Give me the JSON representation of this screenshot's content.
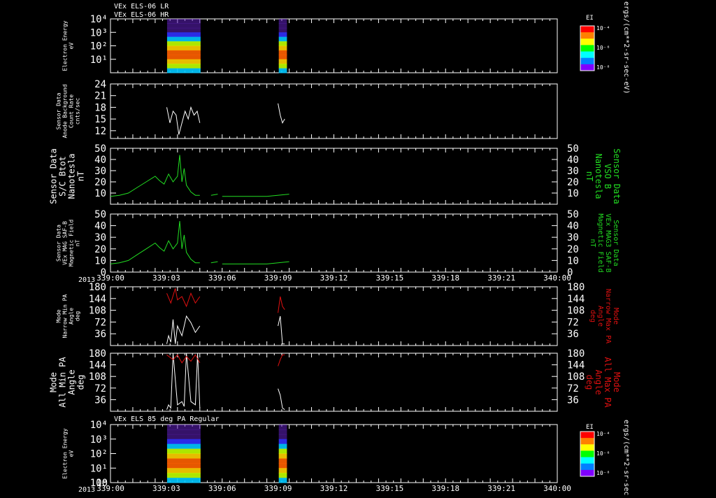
{
  "header": {
    "line1": "VEx ELS-06 LR",
    "line2": "VEx ELS-06 HR",
    "bottom_panel_title": "VEx ELS 85 deg PA Regular",
    "year": "2013"
  },
  "colors": {
    "white": "#ffffff",
    "green": "#22dd22",
    "red": "#e01010",
    "background": "#000000"
  },
  "time_axis": {
    "start": "339:00",
    "end": "340:00",
    "ticks": [
      "339:00",
      "339:03",
      "339:06",
      "339:09",
      "339:12",
      "339:15",
      "339:18",
      "339:21",
      "340:00"
    ],
    "major_tick_fractions": [
      0,
      0.125,
      0.25,
      0.375,
      0.5,
      0.625,
      0.75,
      0.875,
      1.0
    ]
  },
  "colorbar": {
    "label": "EI",
    "units": "ergs/(cm**2-sr-sec-eV)",
    "tick_labels": [
      "10⁻⁴",
      "10⁻⁶",
      "10⁻⁸"
    ]
  },
  "chart_data": [
    {
      "type": "heatmap",
      "ylabel": [
        "Electron Energy",
        "eV"
      ],
      "y_scale": "log",
      "ylim": [
        1,
        10000
      ],
      "y_tick_labels": [
        "10⁴",
        "10³",
        "10²",
        "10¹"
      ],
      "data_intervals": [
        [
          "339:07.6",
          "339:12.1"
        ],
        [
          "339:22.6",
          "339:23.7"
        ]
      ],
      "colorbar": true
    },
    {
      "type": "line",
      "ylabel": [
        "Sensor Data",
        "Anode Background",
        "Count Rate",
        "cnts/sec"
      ],
      "ylim": [
        10,
        24
      ],
      "y_ticks": [
        12,
        15,
        18,
        21,
        24
      ],
      "series": [
        {
          "color": "white",
          "segments": [
            {
              "t": [
                339.126,
                339.133,
                339.14,
                339.147,
                339.153,
                339.16,
                339.167,
                339.174,
                339.18,
                339.187,
                339.194,
                339.2
              ],
              "v": [
                18,
                14,
                17,
                16,
                11,
                14,
                17,
                15,
                18,
                16,
                17,
                14
              ]
            },
            {
              "t": [
                339.375,
                339.38,
                339.385,
                339.39
              ],
              "v": [
                19,
                16,
                14,
                15
              ]
            }
          ]
        }
      ]
    },
    {
      "type": "line",
      "ylabel": [
        "Sensor Data",
        "S/C Btot",
        "Nanotesla",
        "nT"
      ],
      "ylabel_right": [
        "Sensor Data",
        "VSO B",
        "Nanotesla",
        "nT"
      ],
      "ylim": [
        0,
        50
      ],
      "y_ticks": [
        10,
        20,
        30,
        40,
        50
      ],
      "series": [
        {
          "color": "green",
          "segments": [
            {
              "t": [
                339.0,
                339.02,
                339.04,
                339.06,
                339.08,
                339.1,
                339.11,
                339.12,
                339.13,
                339.14,
                339.15,
                339.155,
                339.16,
                339.165,
                339.17,
                339.18,
                339.19,
                339.2
              ],
              "v": [
                7,
                8,
                10,
                15,
                20,
                25,
                21,
                18,
                27,
                20,
                25,
                44,
                20,
                32,
                17,
                11,
                8,
                8
              ]
            },
            {
              "t": [
                339.225,
                339.24
              ],
              "v": [
                8,
                9
              ]
            },
            {
              "t": [
                339.25,
                339.3,
                339.35,
                339.4
              ],
              "v": [
                7,
                7,
                7,
                9
              ]
            }
          ]
        }
      ]
    },
    {
      "type": "line",
      "ylabel": [
        "Sensor Data",
        "VEx MAG SAF-B",
        "Magnetic Field",
        "nT"
      ],
      "ylabel_right": [
        "Sensor Data",
        "VEx MAG3 SAF-B",
        "Magnetic Field",
        "nT"
      ],
      "ylim": [
        0,
        50
      ],
      "y_ticks": [
        0,
        10,
        20,
        30,
        40,
        50
      ],
      "series": [
        {
          "color": "green",
          "segments": [
            {
              "t": [
                339.0,
                339.02,
                339.04,
                339.06,
                339.08,
                339.1,
                339.11,
                339.12,
                339.13,
                339.14,
                339.15,
                339.155,
                339.16,
                339.165,
                339.17,
                339.18,
                339.19,
                339.2
              ],
              "v": [
                7,
                8,
                10,
                15,
                20,
                25,
                21,
                18,
                27,
                20,
                25,
                44,
                20,
                32,
                17,
                11,
                8,
                8
              ]
            },
            {
              "t": [
                339.225,
                339.24
              ],
              "v": [
                8,
                9
              ]
            },
            {
              "t": [
                339.25,
                339.3,
                339.35,
                339.4
              ],
              "v": [
                7,
                7,
                7,
                9
              ]
            }
          ]
        }
      ]
    },
    {
      "type": "line",
      "ylabel": [
        "Mode",
        "Narrow Min PA",
        "Angle",
        "deg"
      ],
      "ylabel_right": [
        "Mode",
        "Narrow Max PA",
        "Angle",
        "deg"
      ],
      "ylim": [
        0,
        180
      ],
      "y_ticks": [
        36,
        72,
        108,
        144,
        180
      ],
      "series": [
        {
          "name": "Narrow Min PA",
          "color": "white",
          "segments": [
            {
              "t": [
                339.126,
                339.13,
                339.135,
                339.14,
                339.145,
                339.15,
                339.16,
                339.17,
                339.18,
                339.19,
                339.2
              ],
              "v": [
                5,
                30,
                10,
                80,
                5,
                60,
                30,
                90,
                70,
                40,
                60
              ]
            },
            {
              "t": [
                339.375,
                339.38,
                339.385,
                339.39
              ],
              "v": [
                60,
                90,
                5,
                5
              ]
            }
          ]
        },
        {
          "name": "Narrow Max PA",
          "color": "red",
          "segments": [
            {
              "t": [
                339.126,
                339.135,
                339.145,
                339.15,
                339.16,
                339.17,
                339.18,
                339.19,
                339.2
              ],
              "v": [
                160,
                130,
                175,
                140,
                150,
                120,
                160,
                130,
                150
              ]
            },
            {
              "t": [
                339.375,
                339.38,
                339.385,
                339.39
              ],
              "v": [
                100,
                150,
                120,
                110
              ]
            }
          ]
        }
      ]
    },
    {
      "type": "line",
      "ylabel": [
        "Mode",
        "All Min PA",
        "Angle",
        "deg"
      ],
      "ylabel_right": [
        "Mode",
        "All Max PA",
        "Angle",
        "deg"
      ],
      "ylim": [
        0,
        180
      ],
      "y_ticks": [
        36,
        72,
        108,
        144,
        180
      ],
      "series": [
        {
          "name": "All Min PA",
          "color": "white",
          "segments": [
            {
              "t": [
                339.126,
                339.13,
                339.135,
                339.14,
                339.15,
                339.16,
                339.165,
                339.17,
                339.18,
                339.19,
                339.195,
                339.2
              ],
              "v": [
                5,
                20,
                10,
                180,
                20,
                30,
                15,
                180,
                30,
                20,
                180,
                10
              ]
            },
            {
              "t": [
                339.375,
                339.38,
                339.385,
                339.39
              ],
              "v": [
                70,
                50,
                10,
                5
              ]
            }
          ]
        },
        {
          "name": "All Max PA",
          "color": "red",
          "segments": [
            {
              "t": [
                339.126,
                339.14,
                339.15,
                339.16,
                339.17,
                339.18,
                339.19,
                339.2
              ],
              "v": [
                175,
                160,
                175,
                150,
                170,
                155,
                175,
                150
              ]
            },
            {
              "t": [
                339.375,
                339.38,
                339.385,
                339.39
              ],
              "v": [
                140,
                160,
                175,
                175
              ]
            }
          ]
        }
      ]
    },
    {
      "type": "heatmap",
      "ylabel": [
        "Electron Energy",
        "eV"
      ],
      "y_scale": "log",
      "ylim": [
        1,
        10000
      ],
      "y_tick_labels": [
        "10⁴",
        "10³",
        "10²",
        "10¹",
        "10⁰",
        "10"
      ],
      "data_intervals": [
        [
          "339:07.6",
          "339:12.1"
        ],
        [
          "339:22.6",
          "339:23.7"
        ]
      ],
      "colorbar": true
    }
  ]
}
